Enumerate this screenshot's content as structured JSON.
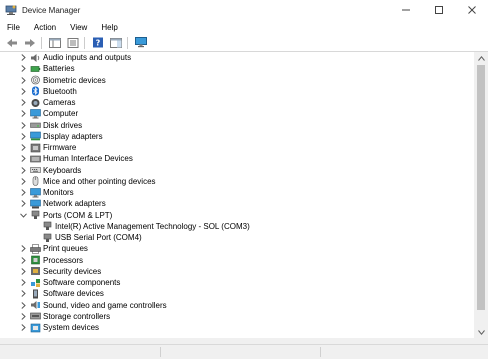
{
  "window": {
    "title": "Device Manager",
    "minimize_glyph": "—",
    "maximize_glyph": "☐",
    "close_glyph": "✕"
  },
  "menu": [
    "File",
    "Action",
    "View",
    "Help"
  ],
  "toolbar": {
    "buttons": [
      "back-icon",
      "forward-icon",
      "show-hide-console-tree-icon",
      "properties-icon",
      "help-icon",
      "action-pane-icon",
      "monitor-icon"
    ]
  },
  "tree": {
    "items": [
      {
        "label": "Audio inputs and outputs",
        "icon": "speaker-icon",
        "expanded": false
      },
      {
        "label": "Batteries",
        "icon": "battery-icon",
        "expanded": false
      },
      {
        "label": "Biometric devices",
        "icon": "fingerprint-icon",
        "expanded": false
      },
      {
        "label": "Bluetooth",
        "icon": "bluetooth-icon",
        "expanded": false
      },
      {
        "label": "Cameras",
        "icon": "camera-icon",
        "expanded": false
      },
      {
        "label": "Computer",
        "icon": "computer-icon",
        "expanded": false
      },
      {
        "label": "Disk drives",
        "icon": "disk-drive-icon",
        "expanded": false
      },
      {
        "label": "Display adapters",
        "icon": "display-adapter-icon",
        "expanded": false
      },
      {
        "label": "Firmware",
        "icon": "firmware-icon",
        "expanded": false
      },
      {
        "label": "Human Interface Devices",
        "icon": "hid-icon",
        "expanded": false
      },
      {
        "label": "Keyboards",
        "icon": "keyboard-icon",
        "expanded": false
      },
      {
        "label": "Mice and other pointing devices",
        "icon": "mouse-icon",
        "expanded": false
      },
      {
        "label": "Monitors",
        "icon": "monitor-icon",
        "expanded": false
      },
      {
        "label": "Network adapters",
        "icon": "network-adapter-icon",
        "expanded": false
      },
      {
        "label": "Ports (COM & LPT)",
        "icon": "port-icon",
        "expanded": true
      },
      {
        "label": "Intel(R) Active Management Technology - SOL (COM3)",
        "icon": "port-icon",
        "child": true
      },
      {
        "label": "USB Serial Port (COM4)",
        "icon": "port-icon",
        "child": true
      },
      {
        "label": "Print queues",
        "icon": "printer-icon",
        "expanded": false
      },
      {
        "label": "Processors",
        "icon": "processor-icon",
        "expanded": false
      },
      {
        "label": "Security devices",
        "icon": "security-icon",
        "expanded": false
      },
      {
        "label": "Software components",
        "icon": "software-component-icon",
        "expanded": false
      },
      {
        "label": "Software devices",
        "icon": "software-device-icon",
        "expanded": false
      },
      {
        "label": "Sound, video and game controllers",
        "icon": "sound-icon",
        "expanded": false
      },
      {
        "label": "Storage controllers",
        "icon": "storage-controller-icon",
        "expanded": false
      },
      {
        "label": "System devices",
        "icon": "system-device-icon",
        "expanded": false
      }
    ]
  },
  "colors": {
    "accent": "#1e90ff",
    "chevron": "#555555",
    "scrollbar_track": "#f0f0f0",
    "scrollbar_thumb": "#c2c2c2"
  }
}
